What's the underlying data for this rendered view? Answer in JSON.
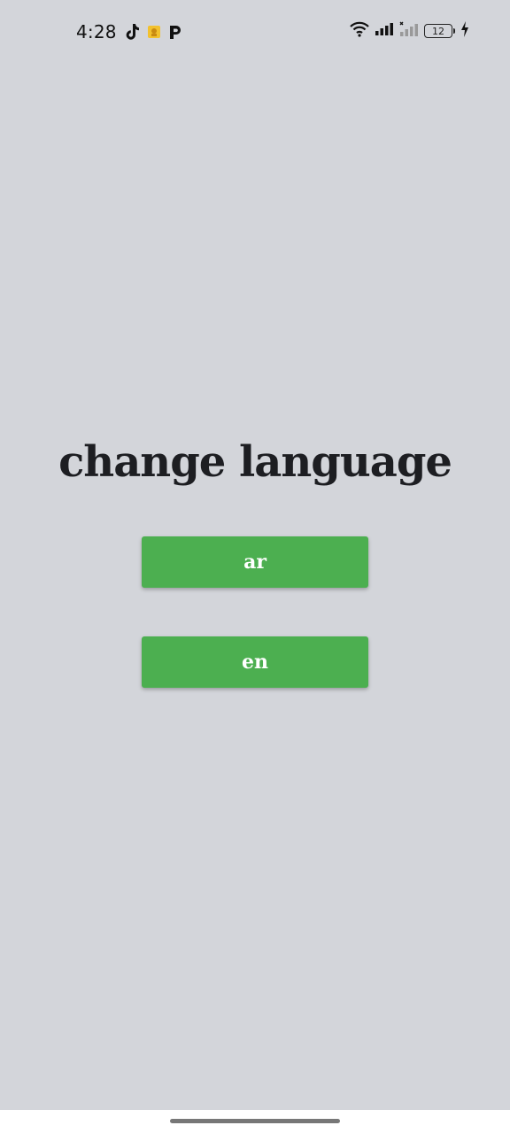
{
  "status_bar": {
    "time": "4:28",
    "battery_level": "12",
    "notification_icons": [
      "tiktok-icon",
      "app-badge-icon",
      "p-app-icon"
    ],
    "system_icons": [
      "wifi-icon",
      "signal-icon",
      "signal-no-service-icon",
      "battery-icon",
      "charging-icon"
    ]
  },
  "main": {
    "title": "change language",
    "buttons": [
      {
        "label": "ar"
      },
      {
        "label": "en"
      }
    ]
  },
  "colors": {
    "background": "#d3d5da",
    "button": "#4caf50",
    "button_text": "#ffffff",
    "title_text": "#1d1e22"
  }
}
